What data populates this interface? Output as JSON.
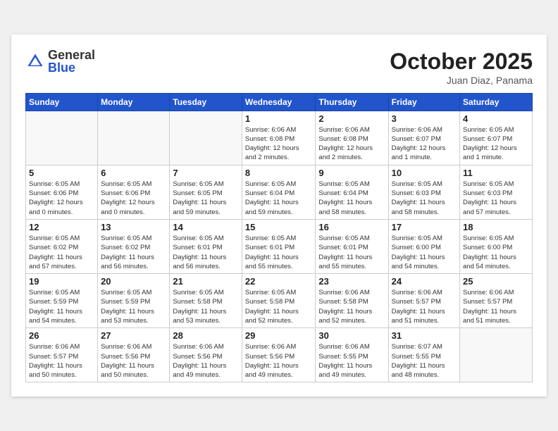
{
  "header": {
    "logo_general": "General",
    "logo_blue": "Blue",
    "month_title": "October 2025",
    "subtitle": "Juan Diaz, Panama"
  },
  "days_of_week": [
    "Sunday",
    "Monday",
    "Tuesday",
    "Wednesday",
    "Thursday",
    "Friday",
    "Saturday"
  ],
  "weeks": [
    [
      {
        "day": "",
        "info": ""
      },
      {
        "day": "",
        "info": ""
      },
      {
        "day": "",
        "info": ""
      },
      {
        "day": "1",
        "info": "Sunrise: 6:06 AM\nSunset: 6:08 PM\nDaylight: 12 hours\nand 2 minutes."
      },
      {
        "day": "2",
        "info": "Sunrise: 6:06 AM\nSunset: 6:08 PM\nDaylight: 12 hours\nand 2 minutes."
      },
      {
        "day": "3",
        "info": "Sunrise: 6:06 AM\nSunset: 6:07 PM\nDaylight: 12 hours\nand 1 minute."
      },
      {
        "day": "4",
        "info": "Sunrise: 6:05 AM\nSunset: 6:07 PM\nDaylight: 12 hours\nand 1 minute."
      }
    ],
    [
      {
        "day": "5",
        "info": "Sunrise: 6:05 AM\nSunset: 6:06 PM\nDaylight: 12 hours\nand 0 minutes."
      },
      {
        "day": "6",
        "info": "Sunrise: 6:05 AM\nSunset: 6:06 PM\nDaylight: 12 hours\nand 0 minutes."
      },
      {
        "day": "7",
        "info": "Sunrise: 6:05 AM\nSunset: 6:05 PM\nDaylight: 11 hours\nand 59 minutes."
      },
      {
        "day": "8",
        "info": "Sunrise: 6:05 AM\nSunset: 6:04 PM\nDaylight: 11 hours\nand 59 minutes."
      },
      {
        "day": "9",
        "info": "Sunrise: 6:05 AM\nSunset: 6:04 PM\nDaylight: 11 hours\nand 58 minutes."
      },
      {
        "day": "10",
        "info": "Sunrise: 6:05 AM\nSunset: 6:03 PM\nDaylight: 11 hours\nand 58 minutes."
      },
      {
        "day": "11",
        "info": "Sunrise: 6:05 AM\nSunset: 6:03 PM\nDaylight: 11 hours\nand 57 minutes."
      }
    ],
    [
      {
        "day": "12",
        "info": "Sunrise: 6:05 AM\nSunset: 6:02 PM\nDaylight: 11 hours\nand 57 minutes."
      },
      {
        "day": "13",
        "info": "Sunrise: 6:05 AM\nSunset: 6:02 PM\nDaylight: 11 hours\nand 56 minutes."
      },
      {
        "day": "14",
        "info": "Sunrise: 6:05 AM\nSunset: 6:01 PM\nDaylight: 11 hours\nand 56 minutes."
      },
      {
        "day": "15",
        "info": "Sunrise: 6:05 AM\nSunset: 6:01 PM\nDaylight: 11 hours\nand 55 minutes."
      },
      {
        "day": "16",
        "info": "Sunrise: 6:05 AM\nSunset: 6:01 PM\nDaylight: 11 hours\nand 55 minutes."
      },
      {
        "day": "17",
        "info": "Sunrise: 6:05 AM\nSunset: 6:00 PM\nDaylight: 11 hours\nand 54 minutes."
      },
      {
        "day": "18",
        "info": "Sunrise: 6:05 AM\nSunset: 6:00 PM\nDaylight: 11 hours\nand 54 minutes."
      }
    ],
    [
      {
        "day": "19",
        "info": "Sunrise: 6:05 AM\nSunset: 5:59 PM\nDaylight: 11 hours\nand 54 minutes."
      },
      {
        "day": "20",
        "info": "Sunrise: 6:05 AM\nSunset: 5:59 PM\nDaylight: 11 hours\nand 53 minutes."
      },
      {
        "day": "21",
        "info": "Sunrise: 6:05 AM\nSunset: 5:58 PM\nDaylight: 11 hours\nand 53 minutes."
      },
      {
        "day": "22",
        "info": "Sunrise: 6:05 AM\nSunset: 5:58 PM\nDaylight: 11 hours\nand 52 minutes."
      },
      {
        "day": "23",
        "info": "Sunrise: 6:06 AM\nSunset: 5:58 PM\nDaylight: 11 hours\nand 52 minutes."
      },
      {
        "day": "24",
        "info": "Sunrise: 6:06 AM\nSunset: 5:57 PM\nDaylight: 11 hours\nand 51 minutes."
      },
      {
        "day": "25",
        "info": "Sunrise: 6:06 AM\nSunset: 5:57 PM\nDaylight: 11 hours\nand 51 minutes."
      }
    ],
    [
      {
        "day": "26",
        "info": "Sunrise: 6:06 AM\nSunset: 5:57 PM\nDaylight: 11 hours\nand 50 minutes."
      },
      {
        "day": "27",
        "info": "Sunrise: 6:06 AM\nSunset: 5:56 PM\nDaylight: 11 hours\nand 50 minutes."
      },
      {
        "day": "28",
        "info": "Sunrise: 6:06 AM\nSunset: 5:56 PM\nDaylight: 11 hours\nand 49 minutes."
      },
      {
        "day": "29",
        "info": "Sunrise: 6:06 AM\nSunset: 5:56 PM\nDaylight: 11 hours\nand 49 minutes."
      },
      {
        "day": "30",
        "info": "Sunrise: 6:06 AM\nSunset: 5:55 PM\nDaylight: 11 hours\nand 49 minutes."
      },
      {
        "day": "31",
        "info": "Sunrise: 6:07 AM\nSunset: 5:55 PM\nDaylight: 11 hours\nand 48 minutes."
      },
      {
        "day": "",
        "info": ""
      }
    ]
  ]
}
